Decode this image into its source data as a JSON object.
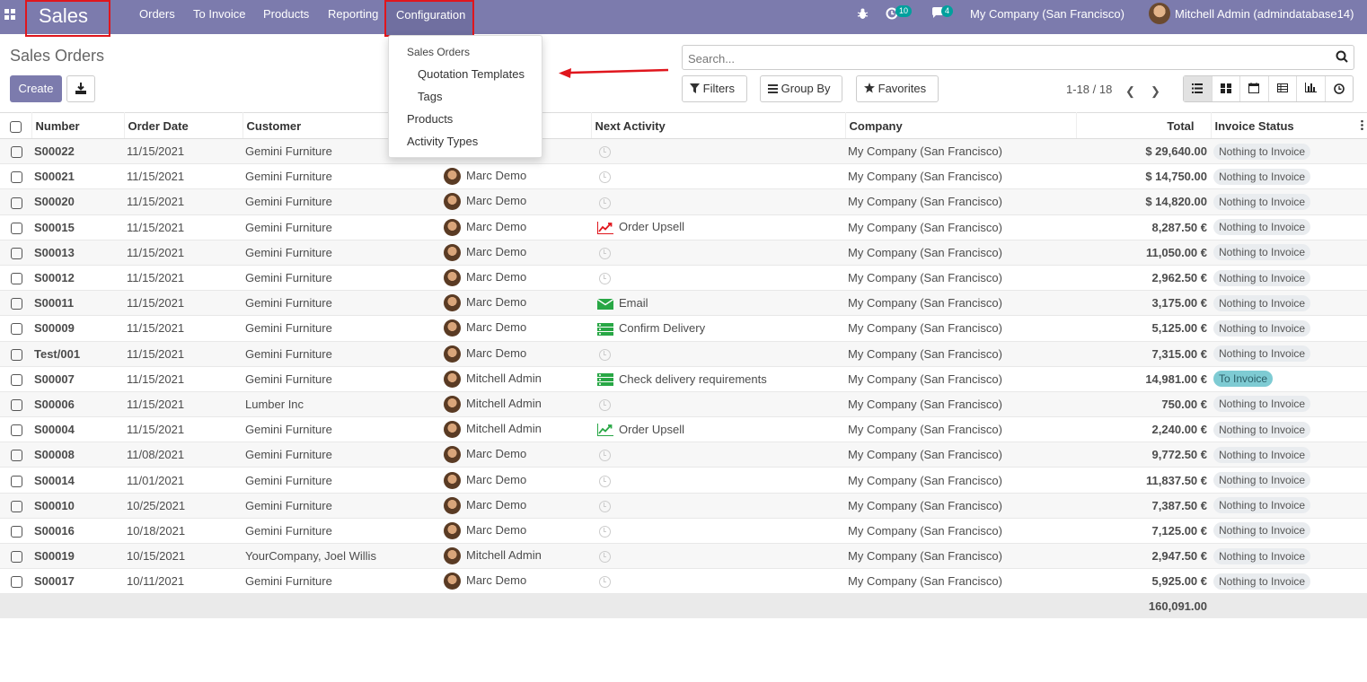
{
  "navbar": {
    "brand": "Sales",
    "menu": [
      "Orders",
      "To Invoice",
      "Products",
      "Reporting"
    ],
    "active_menu": "Configuration",
    "activity_count": "10",
    "message_count": "4",
    "company": "My Company (San Francisco)",
    "user": "Mitchell Admin (admindatabase14)"
  },
  "dropdown": {
    "header": "Sales Orders",
    "items": [
      "Quotation Templates",
      "Tags",
      "Products",
      "Activity Types"
    ]
  },
  "control_panel": {
    "title": "Sales Orders",
    "create_label": "Create",
    "search_placeholder": "Search...",
    "filters_label": "Filters",
    "groupby_label": "Group By",
    "favorites_label": "Favorites",
    "pager": "1-18 / 18"
  },
  "table": {
    "columns": [
      "Number",
      "Order Date",
      "Customer",
      "",
      "Next Activity",
      "Company",
      "Total",
      "Invoice Status"
    ],
    "rows": [
      {
        "number": "S00022",
        "date": "11/15/2021",
        "customer": "Gemini Furniture",
        "salesperson": "",
        "activity": "",
        "activity_icon": "",
        "company": "My Company (San Francisco)",
        "total": "$ 29,640.00",
        "status": "Nothing to Invoice"
      },
      {
        "number": "S00021",
        "date": "11/15/2021",
        "customer": "Gemini Furniture",
        "salesperson": "Marc Demo",
        "activity": "",
        "activity_icon": "",
        "company": "My Company (San Francisco)",
        "total": "$ 14,750.00",
        "status": "Nothing to Invoice"
      },
      {
        "number": "S00020",
        "date": "11/15/2021",
        "customer": "Gemini Furniture",
        "salesperson": "Marc Demo",
        "activity": "",
        "activity_icon": "",
        "company": "My Company (San Francisco)",
        "total": "$ 14,820.00",
        "status": "Nothing to Invoice"
      },
      {
        "number": "S00015",
        "date": "11/15/2021",
        "customer": "Gemini Furniture",
        "salesperson": "Marc Demo",
        "activity": "Order Upsell",
        "activity_icon": "upsell-red",
        "company": "My Company (San Francisco)",
        "total": "8,287.50 €",
        "status": "Nothing to Invoice"
      },
      {
        "number": "S00013",
        "date": "11/15/2021",
        "customer": "Gemini Furniture",
        "salesperson": "Marc Demo",
        "activity": "",
        "activity_icon": "",
        "company": "My Company (San Francisco)",
        "total": "11,050.00 €",
        "status": "Nothing to Invoice"
      },
      {
        "number": "S00012",
        "date": "11/15/2021",
        "customer": "Gemini Furniture",
        "salesperson": "Marc Demo",
        "activity": "",
        "activity_icon": "",
        "company": "My Company (San Francisco)",
        "total": "2,962.50 €",
        "status": "Nothing to Invoice"
      },
      {
        "number": "S00011",
        "date": "11/15/2021",
        "customer": "Gemini Furniture",
        "salesperson": "Marc Demo",
        "activity": "Email",
        "activity_icon": "email",
        "company": "My Company (San Francisco)",
        "total": "3,175.00 €",
        "status": "Nothing to Invoice"
      },
      {
        "number": "S00009",
        "date": "11/15/2021",
        "customer": "Gemini Furniture",
        "salesperson": "Marc Demo",
        "activity": "Confirm Delivery",
        "activity_icon": "tasks",
        "company": "My Company (San Francisco)",
        "total": "5,125.00 €",
        "status": "Nothing to Invoice"
      },
      {
        "number": "Test/001",
        "date": "11/15/2021",
        "customer": "Gemini Furniture",
        "salesperson": "Marc Demo",
        "activity": "",
        "activity_icon": "",
        "company": "My Company (San Francisco)",
        "total": "7,315.00 €",
        "status": "Nothing to Invoice"
      },
      {
        "number": "S00007",
        "date": "11/15/2021",
        "customer": "Gemini Furniture",
        "salesperson": "Mitchell Admin",
        "activity": "Check delivery requirements",
        "activity_icon": "tasks",
        "company": "My Company (San Francisco)",
        "total": "14,981.00 €",
        "status": "To Invoice"
      },
      {
        "number": "S00006",
        "date": "11/15/2021",
        "customer": "Lumber Inc",
        "salesperson": "Mitchell Admin",
        "activity": "",
        "activity_icon": "",
        "company": "My Company (San Francisco)",
        "total": "750.00 €",
        "status": "Nothing to Invoice"
      },
      {
        "number": "S00004",
        "date": "11/15/2021",
        "customer": "Gemini Furniture",
        "salesperson": "Mitchell Admin",
        "activity": "Order Upsell",
        "activity_icon": "upsell-green",
        "company": "My Company (San Francisco)",
        "total": "2,240.00 €",
        "status": "Nothing to Invoice"
      },
      {
        "number": "S00008",
        "date": "11/08/2021",
        "customer": "Gemini Furniture",
        "salesperson": "Marc Demo",
        "activity": "",
        "activity_icon": "",
        "company": "My Company (San Francisco)",
        "total": "9,772.50 €",
        "status": "Nothing to Invoice"
      },
      {
        "number": "S00014",
        "date": "11/01/2021",
        "customer": "Gemini Furniture",
        "salesperson": "Marc Demo",
        "activity": "",
        "activity_icon": "",
        "company": "My Company (San Francisco)",
        "total": "11,837.50 €",
        "status": "Nothing to Invoice"
      },
      {
        "number": "S00010",
        "date": "10/25/2021",
        "customer": "Gemini Furniture",
        "salesperson": "Marc Demo",
        "activity": "",
        "activity_icon": "",
        "company": "My Company (San Francisco)",
        "total": "7,387.50 €",
        "status": "Nothing to Invoice"
      },
      {
        "number": "S00016",
        "date": "10/18/2021",
        "customer": "Gemini Furniture",
        "salesperson": "Marc Demo",
        "activity": "",
        "activity_icon": "",
        "company": "My Company (San Francisco)",
        "total": "7,125.00 €",
        "status": "Nothing to Invoice"
      },
      {
        "number": "S00019",
        "date": "10/15/2021",
        "customer": "YourCompany, Joel Willis",
        "salesperson": "Mitchell Admin",
        "activity": "",
        "activity_icon": "",
        "company": "My Company (San Francisco)",
        "total": "2,947.50 €",
        "status": "Nothing to Invoice"
      },
      {
        "number": "S00017",
        "date": "10/11/2021",
        "customer": "Gemini Furniture",
        "salesperson": "Marc Demo",
        "activity": "",
        "activity_icon": "",
        "company": "My Company (San Francisco)",
        "total": "5,925.00 €",
        "status": "Nothing to Invoice"
      }
    ],
    "grand_total": "160,091.00"
  },
  "colors": {
    "brand": "#7c7bad",
    "highlight_border": "#e0161d",
    "to_invoice_badge": "#7ecbd3",
    "activity_green": "#28a745",
    "activity_red": "#e0161d"
  }
}
